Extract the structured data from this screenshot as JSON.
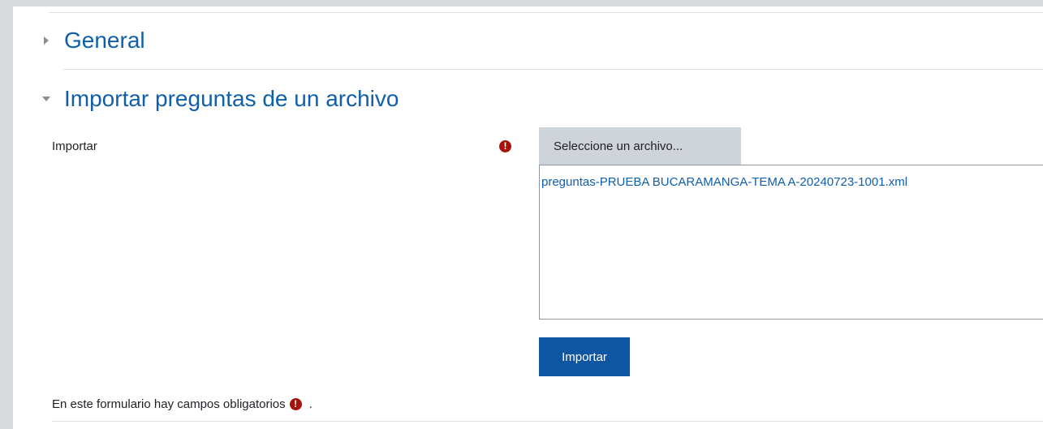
{
  "sections": {
    "general": {
      "title": "General",
      "expanded": false
    },
    "import": {
      "title": "Importar preguntas de un archivo",
      "expanded": true
    }
  },
  "form": {
    "import_label": "Importar",
    "file_picker_button": "Seleccione un archivo...",
    "selected_file": "preguntas-PRUEBA BUCARAMANGA-TEMA A-20240723-1001.xml",
    "submit_label": "Importar",
    "required_note": "En este formulario hay campos obligatorios",
    "required_note_suffix": ".",
    "required_icon_glyph": "!"
  },
  "colors": {
    "link_blue": "#0f5fad",
    "primary_button": "#0f56a2",
    "required_icon": "#a7130b",
    "file_button_bg": "#ced4da"
  },
  "icons": {
    "collapsed_chevron": "chevron-right-icon",
    "expanded_chevron": "chevron-down-icon",
    "required": "exclamation-circle-icon"
  }
}
